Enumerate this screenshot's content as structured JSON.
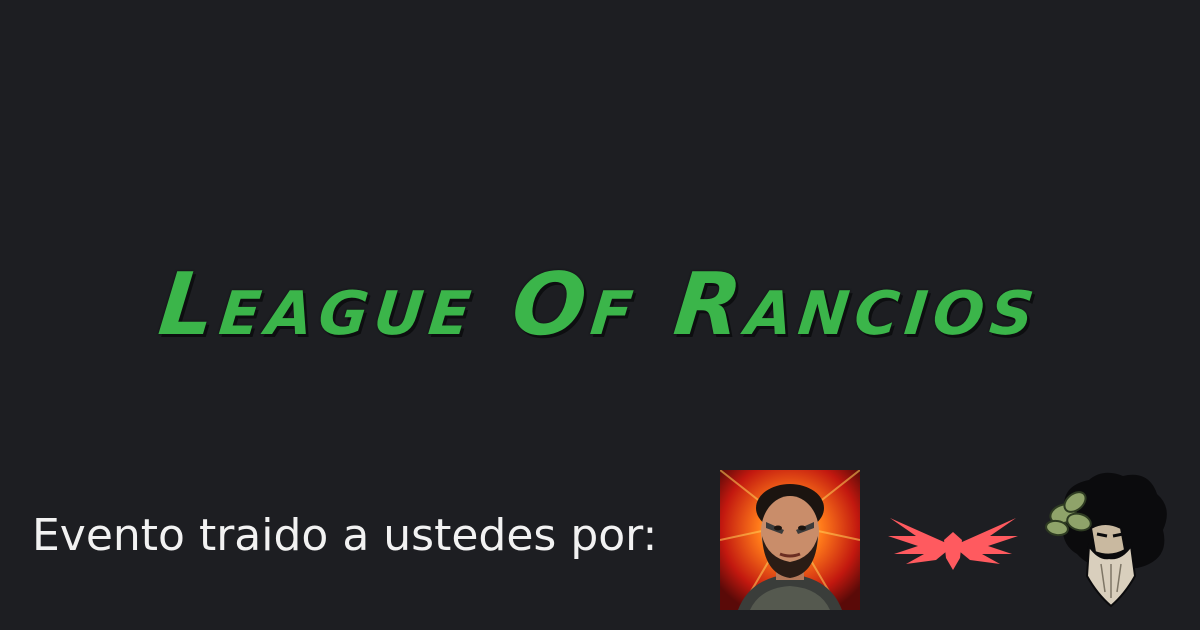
{
  "banner": {
    "title": "League Of Rancios",
    "credit_text": "Evento traido a ustedes por:"
  },
  "logos": [
    {
      "icon": "streamer-portrait-icon"
    },
    {
      "icon": "red-bird-wings-icon"
    },
    {
      "icon": "bearded-bust-icon"
    }
  ],
  "colors": {
    "background": "#1d1e22",
    "title": "#3bb54a",
    "credit_text": "#f2f2f2",
    "bird": "#ff5a5f"
  }
}
